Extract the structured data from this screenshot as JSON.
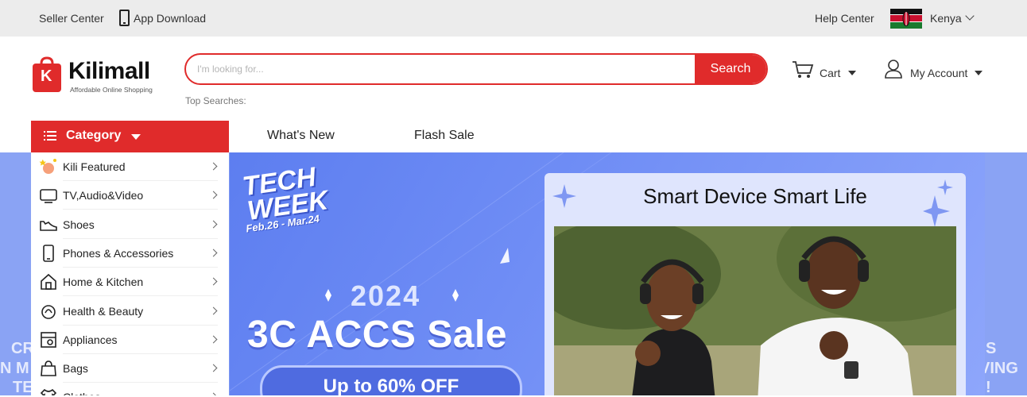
{
  "topbar": {
    "seller_center": "Seller Center",
    "app_download": "App Download",
    "help_center": "Help Center",
    "country": "Kenya"
  },
  "header": {
    "logo_name": "Kilimall",
    "logo_tagline": "Affordable Online Shopping",
    "logo_letter": "K",
    "search_placeholder": "I'm looking for...",
    "search_button": "Search",
    "top_searches_label": "Top Searches:",
    "cart_label": "Cart",
    "account_label": "My Account"
  },
  "nav": {
    "category_label": "Category",
    "links": [
      "What's New",
      "Flash Sale"
    ]
  },
  "sidebar": {
    "items": [
      {
        "label": "Kili Featured",
        "icon": "featured-icon"
      },
      {
        "label": "TV,Audio&Video",
        "icon": "tv-icon"
      },
      {
        "label": "Shoes",
        "icon": "shoe-icon"
      },
      {
        "label": "Phones & Accessories",
        "icon": "phone-icon"
      },
      {
        "label": "Home & Kitchen",
        "icon": "home-icon"
      },
      {
        "label": "Health & Beauty",
        "icon": "beauty-icon"
      },
      {
        "label": "Appliances",
        "icon": "appliance-icon"
      },
      {
        "label": "Bags",
        "icon": "bag-icon"
      },
      {
        "label": "Clothes",
        "icon": "clothes-icon"
      }
    ]
  },
  "banner": {
    "tech": "TECH",
    "week": "WEEK",
    "dates": "Feb.26 - Mar.24",
    "year": "2024",
    "headline": "3C ACCS Sale",
    "discount": "Up to 60% OFF",
    "card_title": "Smart Device Smart Life",
    "side_left": [
      "CR",
      "N M",
      "TE"
    ],
    "side_right": [
      "S",
      "VING",
      "!"
    ]
  },
  "colors": {
    "brand_red": "#e02b2b",
    "banner_blue": "#6f8df5",
    "topbar_gray": "#ececec"
  }
}
